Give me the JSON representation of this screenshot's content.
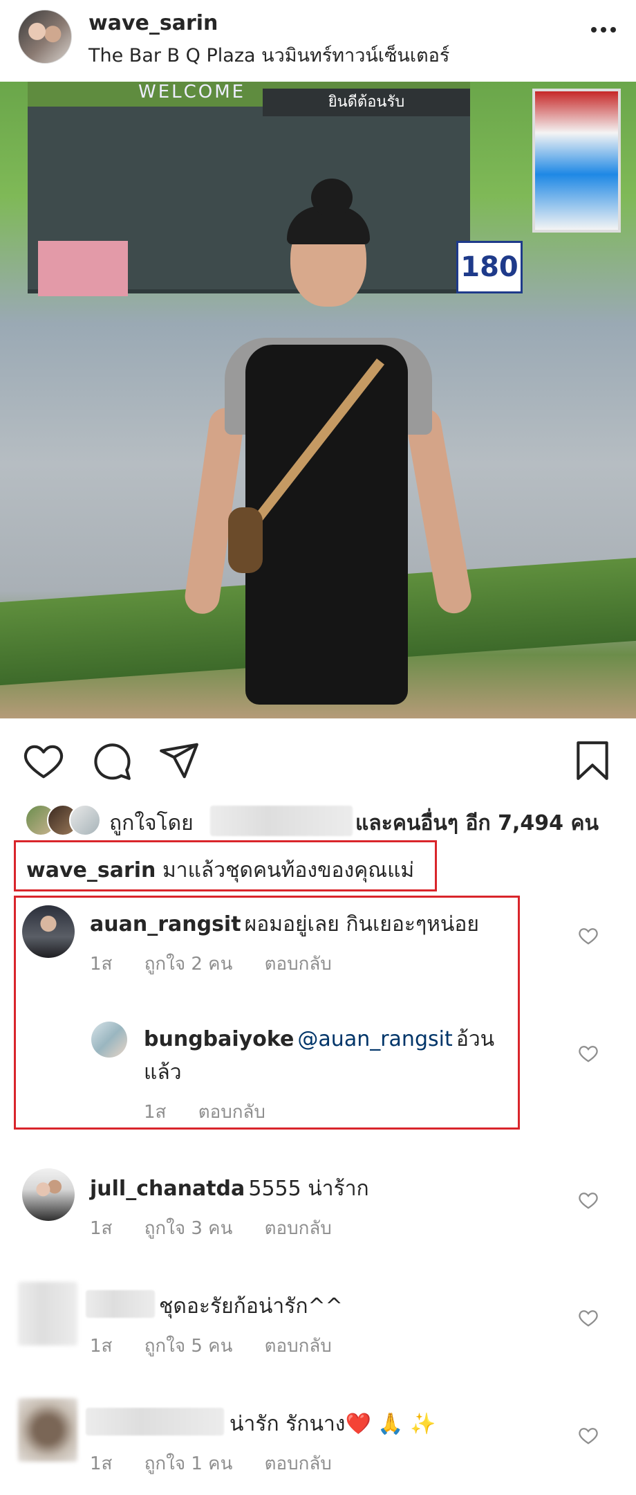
{
  "post": {
    "username": "wave_sarin",
    "location": "The Bar B Q Plaza นวมินทร์ทาวน์เซ็นเตอร์",
    "photo_signs": {
      "welcome": "WELCOME",
      "banner": "ยินดีต้อนรับ",
      "price": "180"
    }
  },
  "likes": {
    "prefix": "ถูกใจโดย",
    "suffix": "และคนอื่นๆ อีก 7,494 คน"
  },
  "caption": {
    "username": "wave_sarin",
    "text": "มาแล้วชุดคนท้องของคุณแม่"
  },
  "comments": [
    {
      "username": "auan_rangsit",
      "text": "ผอมอยู่เลย กินเยอะๆหน่อย",
      "time": "1ส",
      "likes": "ถูกใจ 2 คน",
      "reply": "ตอบกลับ"
    },
    {
      "username": "bungbaiyoke",
      "mention": "@auan_rangsit",
      "text_line1": "อ้วน",
      "text_line2": "แล้ว",
      "time": "1ส",
      "reply": "ตอบกลับ"
    },
    {
      "username": "jull_chanatda",
      "text": "5555 น่าร้าก",
      "time": "1ส",
      "likes": "ถูกใจ 3 คน",
      "reply": "ตอบกลับ"
    },
    {
      "text": "ชุดอะรัยก้อน่ารัก^^",
      "time": "1ส",
      "likes": "ถูกใจ 5 คน",
      "reply": "ตอบกลับ"
    },
    {
      "text": "น่ารัก รักนาง❤️ 🙏 ✨",
      "time": "1ส",
      "likes": "ถูกใจ 1 คน",
      "reply": "ตอบกลับ"
    }
  ],
  "colors": {
    "highlight": "#d9252b",
    "mention": "#003569",
    "meta": "#8e8e8e"
  },
  "icons": [
    "more-icon",
    "heart-icon",
    "comment-icon",
    "share-icon",
    "bookmark-icon",
    "small-heart-icon"
  ]
}
